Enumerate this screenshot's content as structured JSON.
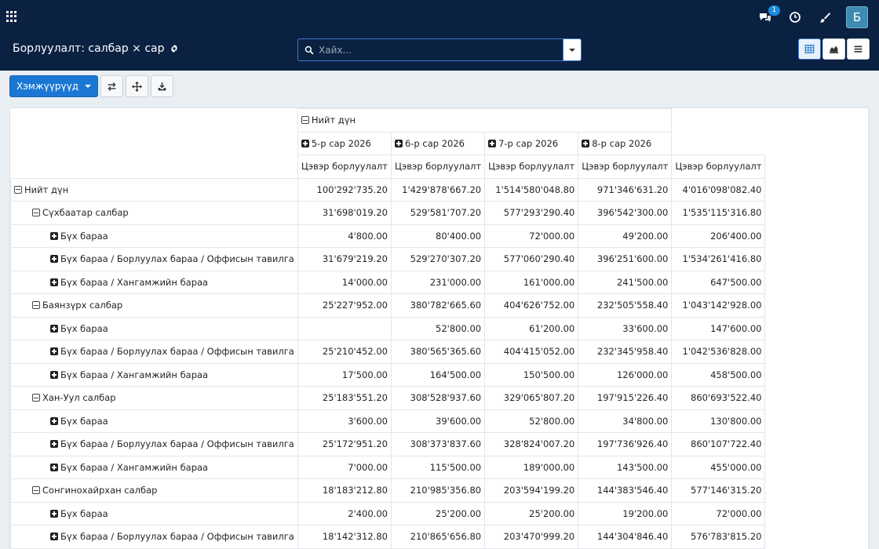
{
  "nav": {
    "apps_icon": "apps-grid-icon",
    "messages_icon": "chat-icon",
    "messages_badge": "1",
    "activity_icon": "clock-icon",
    "theme_icon": "brush-icon",
    "avatar_letter": "Б"
  },
  "control": {
    "title": "Борлуулалт: салбар × сар",
    "search_placeholder": "Хайх..."
  },
  "toolbar": {
    "measures_label": "Хэмжүүрүүд"
  },
  "pivot": {
    "total_header": "Нийт дүн",
    "months": [
      "5-р сар 2026",
      "6-р сар 2026",
      "7-р сар 2026",
      "8-р сар 2026"
    ],
    "measure": "Цэвэр борлуулалт",
    "rows": [
      {
        "level": 0,
        "expand": "minus",
        "label": "Нийт дүн",
        "values": [
          "100'292'735.20",
          "1'429'878'667.20",
          "1'514'580'048.80",
          "971'346'631.20",
          "4'016'098'082.40"
        ]
      },
      {
        "level": 1,
        "expand": "minus",
        "label": "Сүхбаатар салбар",
        "values": [
          "31'698'019.20",
          "529'581'707.20",
          "577'293'290.40",
          "396'542'300.00",
          "1'535'115'316.80"
        ]
      },
      {
        "level": 2,
        "expand": "plus",
        "label": "Бүх бараа",
        "values": [
          "4'800.00",
          "80'400.00",
          "72'000.00",
          "49'200.00",
          "206'400.00"
        ]
      },
      {
        "level": 2,
        "expand": "plus",
        "label": "Бүх бараа / Борлуулах бараа / Оффисын тавилга",
        "values": [
          "31'679'219.20",
          "529'270'307.20",
          "577'060'290.40",
          "396'251'600.00",
          "1'534'261'416.80"
        ]
      },
      {
        "level": 2,
        "expand": "plus",
        "label": "Бүх бараа / Хангамжийн бараа",
        "values": [
          "14'000.00",
          "231'000.00",
          "161'000.00",
          "241'500.00",
          "647'500.00"
        ]
      },
      {
        "level": 1,
        "expand": "minus",
        "label": "Баянзүрх салбар",
        "values": [
          "25'227'952.00",
          "380'782'665.60",
          "404'626'752.00",
          "232'505'558.40",
          "1'043'142'928.00"
        ]
      },
      {
        "level": 2,
        "expand": "plus",
        "label": "Бүх бараа",
        "values": [
          "",
          "52'800.00",
          "61'200.00",
          "33'600.00",
          "147'600.00"
        ]
      },
      {
        "level": 2,
        "expand": "plus",
        "label": "Бүх бараа / Борлуулах бараа / Оффисын тавилга",
        "values": [
          "25'210'452.00",
          "380'565'365.60",
          "404'415'052.00",
          "232'345'958.40",
          "1'042'536'828.00"
        ]
      },
      {
        "level": 2,
        "expand": "plus",
        "label": "Бүх бараа / Хангамжийн бараа",
        "values": [
          "17'500.00",
          "164'500.00",
          "150'500.00",
          "126'000.00",
          "458'500.00"
        ]
      },
      {
        "level": 1,
        "expand": "minus",
        "label": "Хан-Уул салбар",
        "values": [
          "25'183'551.20",
          "308'528'937.60",
          "329'065'807.20",
          "197'915'226.40",
          "860'693'522.40"
        ]
      },
      {
        "level": 2,
        "expand": "plus",
        "label": "Бүх бараа",
        "values": [
          "3'600.00",
          "39'600.00",
          "52'800.00",
          "34'800.00",
          "130'800.00"
        ]
      },
      {
        "level": 2,
        "expand": "plus",
        "label": "Бүх бараа / Борлуулах бараа / Оффисын тавилга",
        "values": [
          "25'172'951.20",
          "308'373'837.60",
          "328'824'007.20",
          "197'736'926.40",
          "860'107'722.40"
        ]
      },
      {
        "level": 2,
        "expand": "plus",
        "label": "Бүх бараа / Хангамжийн бараа",
        "values": [
          "7'000.00",
          "115'500.00",
          "189'000.00",
          "143'500.00",
          "455'000.00"
        ]
      },
      {
        "level": 1,
        "expand": "minus",
        "label": "Сонгинохайрхан салбар",
        "values": [
          "18'183'212.80",
          "210'985'356.80",
          "203'594'199.20",
          "144'383'546.40",
          "577'146'315.20"
        ]
      },
      {
        "level": 2,
        "expand": "plus",
        "label": "Бүх бараа",
        "values": [
          "2'400.00",
          "25'200.00",
          "25'200.00",
          "19'200.00",
          "72'000.00"
        ]
      },
      {
        "level": 2,
        "expand": "plus",
        "label": "Бүх бараа / Борлуулах бараа / Оффисын тавилга",
        "values": [
          "18'142'312.80",
          "210'865'656.80",
          "203'470'999.20",
          "144'304'846.40",
          "576'783'815.20"
        ]
      }
    ]
  }
}
